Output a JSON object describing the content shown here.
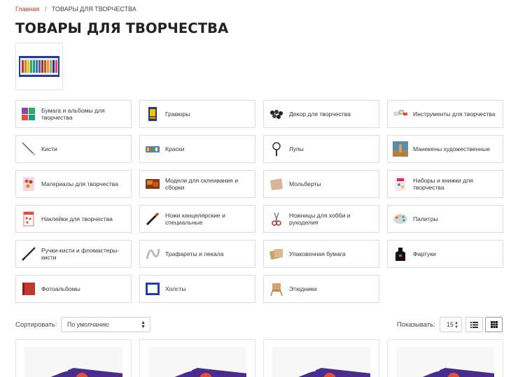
{
  "breadcrumb": {
    "home": "Главная",
    "separator": "/",
    "current": "ТОВАРЫ ДЛЯ ТВОРЧЕСТВА"
  },
  "page_title": "ТОВАРЫ ДЛЯ ТВОРЧЕСТВА",
  "categories": [
    {
      "label": "Бумага и альбомы для творчества",
      "icon": "paper-albums-icon"
    },
    {
      "label": "Гравюры",
      "icon": "engraving-icon"
    },
    {
      "label": "Декор для творчества",
      "icon": "decor-icon"
    },
    {
      "label": "Инструменты для творчества",
      "icon": "tools-icon"
    },
    {
      "label": "Кисти",
      "icon": "brush-icon"
    },
    {
      "label": "Краски",
      "icon": "paints-icon"
    },
    {
      "label": "Лупы",
      "icon": "magnifier-icon"
    },
    {
      "label": "Манекены художественные",
      "icon": "mannequin-icon"
    },
    {
      "label": "Материалы для творчества",
      "icon": "materials-icon"
    },
    {
      "label": "Модели для склеивания и сборки",
      "icon": "models-icon"
    },
    {
      "label": "Мольберты",
      "icon": "easel-icon"
    },
    {
      "label": "Наборы и книжки для творчества",
      "icon": "kits-books-icon"
    },
    {
      "label": "Наклейки для творчества",
      "icon": "stickers-icon"
    },
    {
      "label": "Ножи канцелярские и специальные",
      "icon": "knife-icon"
    },
    {
      "label": "Ножницы для хобби и рукоделия",
      "icon": "scissors-icon"
    },
    {
      "label": "Палитры",
      "icon": "palette-icon"
    },
    {
      "label": "Ручки-кисти и фломастеры-кисти",
      "icon": "brush-pen-icon"
    },
    {
      "label": "Трафареты и лекала",
      "icon": "stencil-icon"
    },
    {
      "label": "Упаковочная бумага",
      "icon": "wrapping-paper-icon"
    },
    {
      "label": "Фартуки",
      "icon": "apron-icon"
    },
    {
      "label": "Фотоальбомы",
      "icon": "photo-album-icon"
    },
    {
      "label": "Холсты",
      "icon": "canvas-icon"
    },
    {
      "label": "Этюдники",
      "icon": "sketchbox-icon"
    }
  ],
  "toolbar": {
    "sort_label": "Сортировать:",
    "sort_value": "По умолчанию",
    "show_label": "Показывать:",
    "show_value": "15"
  },
  "colors": {
    "accent": "#c0392b",
    "border": "#dcdcdc",
    "title": "#222222"
  }
}
